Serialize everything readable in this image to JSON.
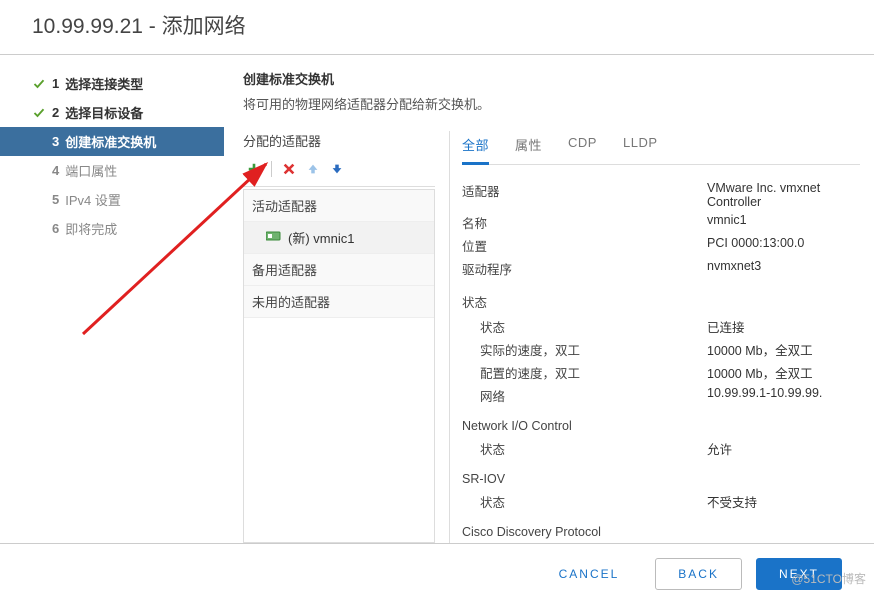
{
  "title_ip": "10.99.99.21",
  "title_sep": " - ",
  "title_action": "添加网络",
  "steps": [
    {
      "num": "1",
      "label": "选择连接类型",
      "status": "completed"
    },
    {
      "num": "2",
      "label": "选择目标设备",
      "status": "completed"
    },
    {
      "num": "3",
      "label": "创建标准交换机",
      "status": "active"
    },
    {
      "num": "4",
      "label": "端口属性",
      "status": "pending"
    },
    {
      "num": "5",
      "label": "IPv4 设置",
      "status": "pending"
    },
    {
      "num": "6",
      "label": "即将完成",
      "status": "pending"
    }
  ],
  "heading": "创建标准交换机",
  "subheading": "将可用的物理网络适配器分配给新交换机。",
  "left_title": "分配的适配器",
  "groups": {
    "active": "活动适配器",
    "standby": "备用适配器",
    "unused": "未用的适配器"
  },
  "adapter_item": "(新) vmnic1",
  "tabs": [
    "全部",
    "属性",
    "CDP",
    "LLDP"
  ],
  "details": {
    "adapter": {
      "k": "适配器",
      "v": "VMware Inc. vmxnet Controller"
    },
    "name": {
      "k": "名称",
      "v": "vmnic1"
    },
    "location": {
      "k": "位置",
      "v": "PCI 0000:13:00.0"
    },
    "driver": {
      "k": "驱动程序",
      "v": "nvmxnet3"
    },
    "status_title": "状态",
    "status": {
      "k": "状态",
      "v": "已连接"
    },
    "actual": {
      "k": "实际的速度，双工",
      "v": "10000 Mb，全双工"
    },
    "configured": {
      "k": "配置的速度，双工",
      "v": "10000 Mb，全双工"
    },
    "network": {
      "k": "网络",
      "v": "10.99.99.1-10.99.99."
    },
    "nioc_title": "Network I/O Control",
    "nioc_status": {
      "k": "状态",
      "v": "允许"
    },
    "sriov_title": "SR-IOV",
    "sriov_status": {
      "k": "状态",
      "v": "不受支持"
    },
    "cdp_title": "Cisco Discovery Protocol"
  },
  "buttons": {
    "cancel": "CANCEL",
    "back": "BACK",
    "next": "NEXT"
  },
  "watermark": "@51CTO博客"
}
